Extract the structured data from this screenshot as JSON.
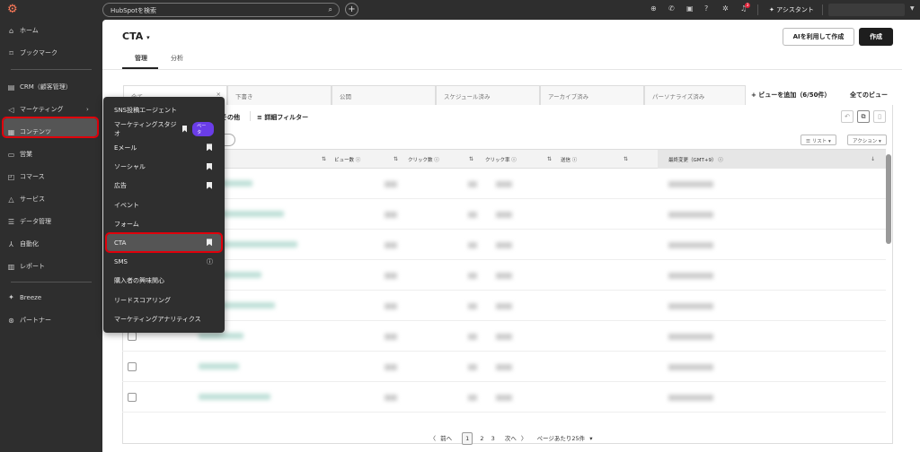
{
  "topbar": {
    "search_placeholder": "HubSpotを検索",
    "assistant": "アシスタント",
    "notification_count": "3"
  },
  "sidebar": {
    "items": [
      {
        "label": "ホーム",
        "icon": "home-icon"
      },
      {
        "label": "ブックマーク",
        "icon": "bookmark-icon"
      },
      {
        "label": "CRM（顧客管理）",
        "icon": "crm-icon"
      },
      {
        "label": "マーケティング",
        "icon": "megaphone-icon"
      },
      {
        "label": "コンテンツ",
        "icon": "content-icon"
      },
      {
        "label": "営業",
        "icon": "sales-icon"
      },
      {
        "label": "コマース",
        "icon": "commerce-icon"
      },
      {
        "label": "サービス",
        "icon": "service-icon"
      },
      {
        "label": "データ管理",
        "icon": "database-icon"
      },
      {
        "label": "自動化",
        "icon": "automation-icon"
      },
      {
        "label": "レポート",
        "icon": "report-icon"
      },
      {
        "label": "Breeze",
        "icon": "breeze-icon"
      },
      {
        "label": "パートナー",
        "icon": "partner-icon"
      }
    ]
  },
  "menu": {
    "items": [
      {
        "label": "SNS投稿エージェント"
      },
      {
        "label": "マーケティングスタジオ",
        "badge": "ベータ"
      },
      {
        "label": "Eメール"
      },
      {
        "label": "ソーシャル"
      },
      {
        "label": "広告"
      },
      {
        "label": "イベント"
      },
      {
        "label": "フォーム"
      },
      {
        "label": "CTA"
      },
      {
        "label": "SMS"
      },
      {
        "label": "購入者の興味関心"
      },
      {
        "label": "リードスコアリング"
      },
      {
        "label": "マーケティングアナリティクス"
      }
    ]
  },
  "page": {
    "title": "CTA",
    "tabs": [
      "管理",
      "分析"
    ],
    "ai_button": "AIを利用して作成",
    "create_button": "作成"
  },
  "views": {
    "tabs": [
      "全て",
      "下書き",
      "公開",
      "スケジュール済み",
      "アーカイブ済み",
      "パーソナライズ済み"
    ],
    "add_view": "+ ビューを追加（6/50件）",
    "all_views": "全てのビュー"
  },
  "filters": {
    "more": "その他",
    "advanced": "詳細フィルター",
    "list": "リスト",
    "actions": "アクション"
  },
  "table": {
    "columns": [
      "ビュー数",
      "クリック数",
      "クリック率",
      "送信",
      "最終変更（GMT+9）"
    ]
  },
  "pager": {
    "prev": "前へ",
    "pages": [
      "1",
      "2",
      "3"
    ],
    "next": "次へ",
    "per_page": "ページあたり25件"
  },
  "colors": {
    "accent": "#ff7a59",
    "highlight": "#e0000b",
    "beta": "#6a3de8"
  }
}
